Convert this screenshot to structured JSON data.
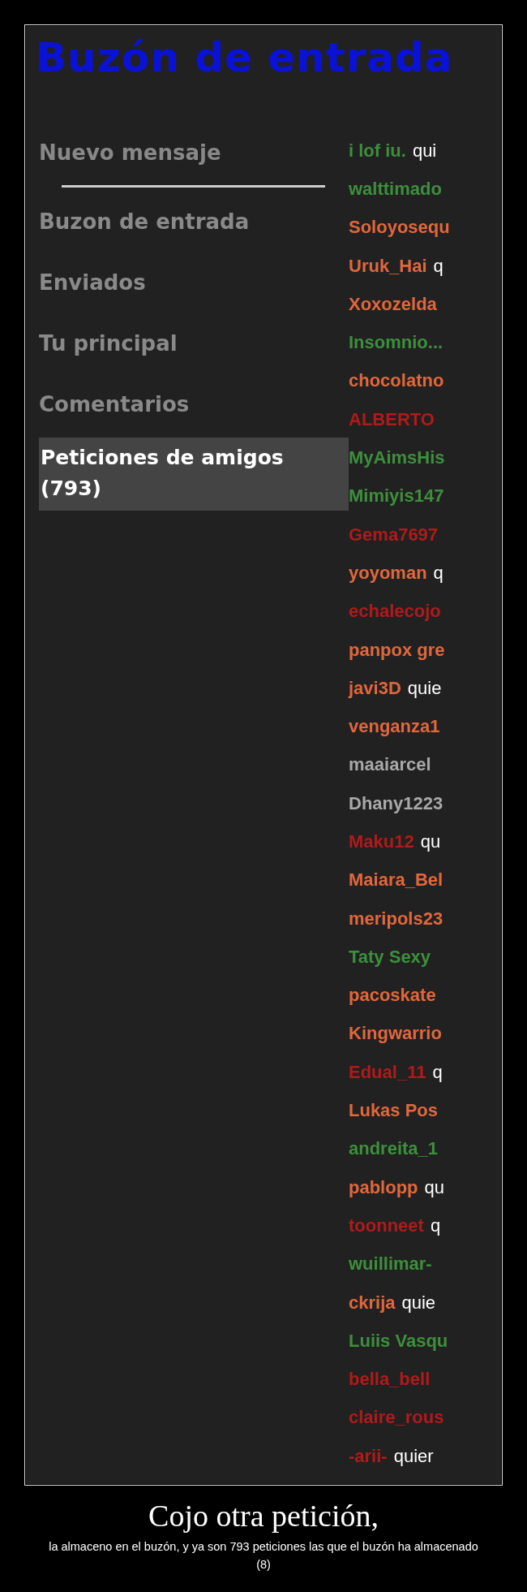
{
  "title": "Buzón de entrada",
  "sidebar": {
    "new_message": "Nuevo mensaje",
    "items": [
      {
        "label": "Buzon de entrada",
        "selected": false
      },
      {
        "label": "Enviados",
        "selected": false
      },
      {
        "label": "Tu principal",
        "selected": false
      },
      {
        "label": "Comentarios",
        "selected": false
      },
      {
        "label": "Peticiones de amigos (793)",
        "selected": true
      }
    ]
  },
  "requests": [
    {
      "name": "i lof iu.",
      "rest": "qui",
      "color": "#3d8f3d"
    },
    {
      "name": "walttimado",
      "color": "#3d8f3d"
    },
    {
      "name": "Soloyosequ",
      "color": "#e2673c"
    },
    {
      "name": "Uruk_Hai",
      "rest": "q",
      "color": "#e2673c"
    },
    {
      "name": "Xoxozelda",
      "color": "#e2673c"
    },
    {
      "name": "Insomnio...",
      "color": "#3d8f3d"
    },
    {
      "name": "chocolatno",
      "color": "#e2673c"
    },
    {
      "name": "ALBERTO",
      "color": "#b01a1a"
    },
    {
      "name": "MyAimsHis",
      "color": "#3d8f3d"
    },
    {
      "name": "Mimiyis147",
      "color": "#3d8f3d"
    },
    {
      "name": "Gema7697",
      "color": "#b01a1a"
    },
    {
      "name": "yoyoman",
      "rest": "q",
      "color": "#e2673c"
    },
    {
      "name": "echalecojo",
      "color": "#b01a1a"
    },
    {
      "name": "panpox gre",
      "color": "#e2673c"
    },
    {
      "name": "javi3D",
      "rest": "quie",
      "color": "#e2673c"
    },
    {
      "name": "venganza1",
      "color": "#e2673c"
    },
    {
      "name": "maaiarcel",
      "color": "#a9a9a9"
    },
    {
      "name": "Dhany1223",
      "color": "#a9a9a9"
    },
    {
      "name": "Maku12",
      "rest": "qu",
      "color": "#b01a1a"
    },
    {
      "name": "Maiara_Bel",
      "color": "#e2673c"
    },
    {
      "name": "meripols23",
      "color": "#e2673c"
    },
    {
      "name": "Taty Sexy",
      "color": "#3d8f3d"
    },
    {
      "name": "pacoskate",
      "color": "#e2673c"
    },
    {
      "name": "Kingwarrio",
      "color": "#e2673c"
    },
    {
      "name": "Edual_11",
      "rest": "q",
      "color": "#b01a1a"
    },
    {
      "name": "Lukas Pos",
      "color": "#e2673c"
    },
    {
      "name": "andreita_1",
      "color": "#3d8f3d"
    },
    {
      "name": "pablopp",
      "rest": "qu",
      "color": "#e2673c"
    },
    {
      "name": "toonneet",
      "rest": "q",
      "color": "#b01a1a"
    },
    {
      "name": "wuillimar-",
      "color": "#3d8f3d"
    },
    {
      "name": "ckrija",
      "rest": "quie",
      "color": "#e2673c"
    },
    {
      "name": "Luiis Vasqu",
      "color": "#3d8f3d"
    },
    {
      "name": "bella_bell",
      "color": "#b01a1a"
    },
    {
      "name": "claire_rous",
      "color": "#b01a1a"
    },
    {
      "name": "-arii-",
      "rest": "quier",
      "color": "#b01a1a"
    }
  ],
  "caption": {
    "title": "Cojo otra petición,",
    "text": "la almaceno en el buzón, y ya son 793 peticiones las que el buzón ha almacenado (8)"
  }
}
